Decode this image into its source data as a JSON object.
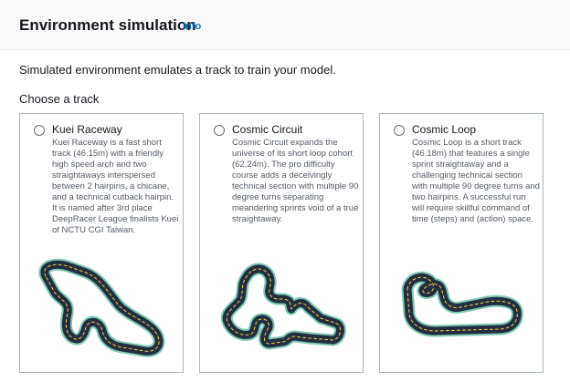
{
  "header": {
    "title": "Environment simulation",
    "info": "Info"
  },
  "description": "Simulated environment emulates a track to train your model.",
  "choose_label": "Choose a track",
  "tracks": [
    {
      "name": "Kuei Raceway",
      "description": "Kuei Raceway is a fast short track (46.15m) with a friendly high speed arch and two straightaways interspersed between 2 hairpins, a chicane, and a technical cutback hairpin. It is named after 3rd place DeepRacer League finalists Kuei of NCTU CGI Taiwan.",
      "selected": false
    },
    {
      "name": "Cosmic Circuit",
      "description": "Cosmic Circuit expands the universe of its short loop cohort (62.24m). The pro difficulty course adds a deceivingly technical section with multiple 90 degree turns separating meandering sprints void of a true straightaway.",
      "selected": false
    },
    {
      "name": "Cosmic Loop",
      "description": "Cosmic Loop is a short track (46.18m) that features a single sprint straightaway and a challenging technical section with multiple 90 degree turns and two hairpins. A successful run will require skillful command of time (steps) and (action) space.",
      "selected": false
    }
  ],
  "colors": {
    "track_edge": "#7fc8b3",
    "track_surface": "#232f3e",
    "center_line": "#f2c94c",
    "link": "#0073bb"
  }
}
